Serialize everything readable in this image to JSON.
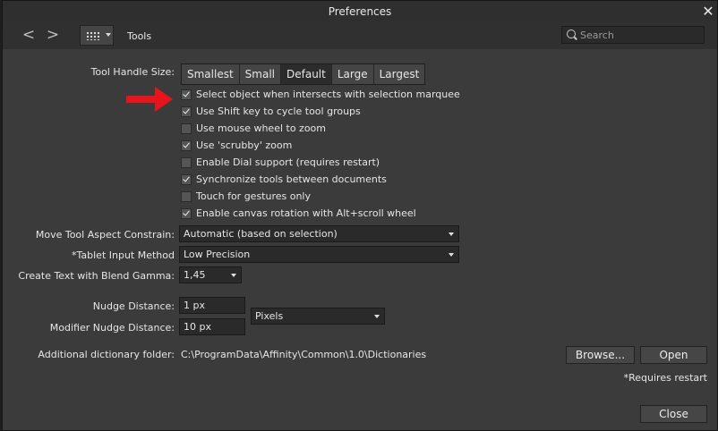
{
  "window": {
    "title": "Preferences"
  },
  "toolbar": {
    "back_glyph": "<",
    "forward_glyph": ">",
    "section_label": "Tools",
    "search_placeholder": "Search"
  },
  "tool_handle": {
    "label": "Tool Handle Size:",
    "options": [
      "Smallest",
      "Small",
      "Default",
      "Large",
      "Largest"
    ],
    "selected": "Default"
  },
  "checkboxes": [
    {
      "label": "Select object when intersects with selection marquee",
      "checked": true
    },
    {
      "label": "Use Shift key to cycle tool groups",
      "checked": true
    },
    {
      "label": "Use mouse wheel to zoom",
      "checked": false
    },
    {
      "label": "Use 'scrubby' zoom",
      "checked": true
    },
    {
      "label": "Enable Dial support (requires restart)",
      "checked": false
    },
    {
      "label": "Synchronize tools between documents",
      "checked": true
    },
    {
      "label": "Touch for gestures only",
      "checked": false
    },
    {
      "label": "Enable canvas rotation with Alt+scroll wheel",
      "checked": true
    }
  ],
  "move_tool": {
    "label": "Move Tool Aspect Constrain:",
    "value": "Automatic (based on selection)"
  },
  "tablet": {
    "label": "*Tablet Input Method",
    "value": "Low Precision"
  },
  "blend_gamma": {
    "label": "Create Text with Blend Gamma:",
    "value": "1,45"
  },
  "nudge": {
    "label": "Nudge Distance:",
    "value": "1 px"
  },
  "modifier_nudge": {
    "label": "Modifier Nudge Distance:",
    "value": "10 px"
  },
  "units": {
    "value": "Pixels"
  },
  "dictionary": {
    "label": "Additional dictionary folder:",
    "path": "C:\\ProgramData\\Affinity\\Common\\1.0\\Dictionaries",
    "browse_label": "Browse...",
    "open_label": "Open"
  },
  "footer": {
    "restart_note": "*Requires restart",
    "close_label": "Close",
    "close_glyph": "✕"
  },
  "colors": {
    "annotation_arrow": "#e8141c",
    "window_bg": "#3b3b3b"
  }
}
